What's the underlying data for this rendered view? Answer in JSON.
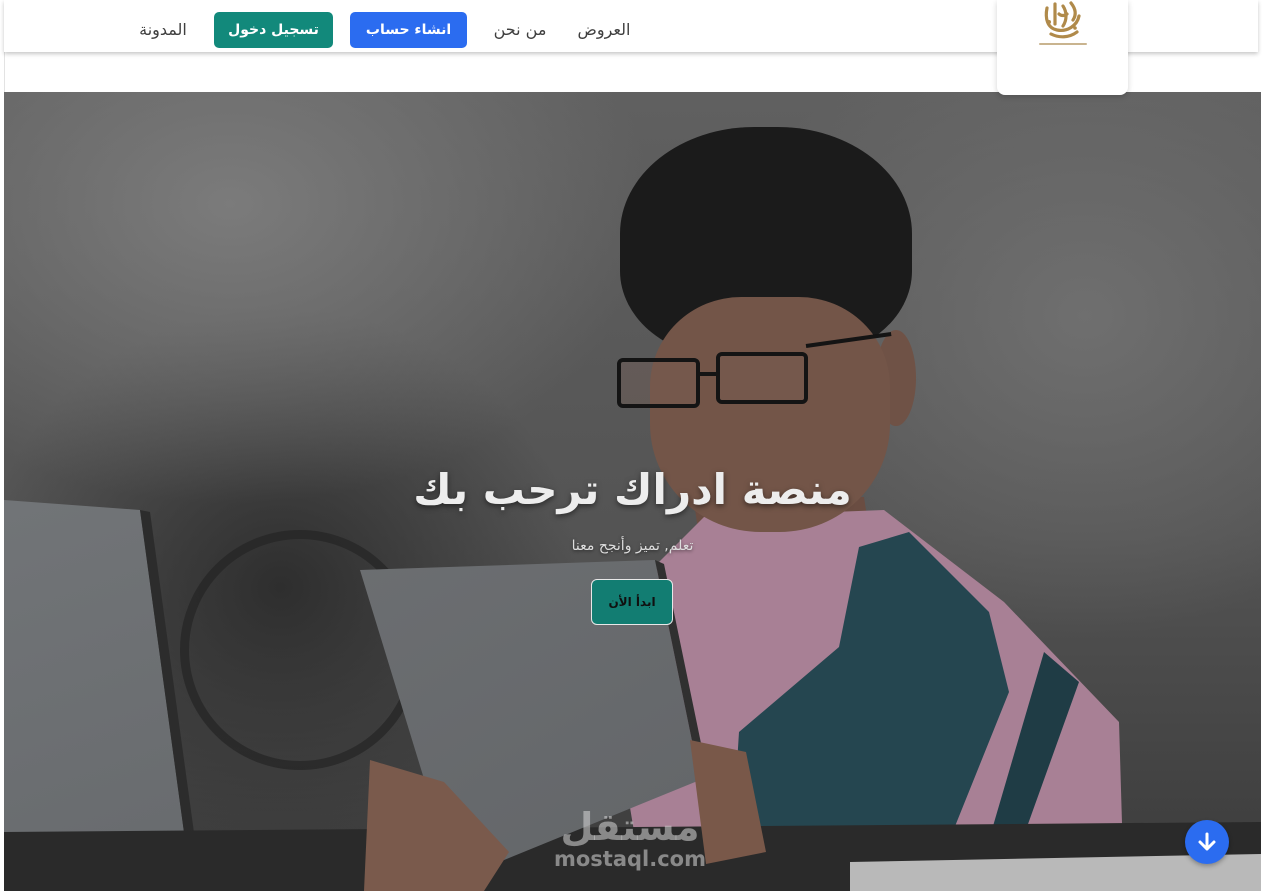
{
  "nav": {
    "items": [
      {
        "label": "العروض"
      },
      {
        "label": "من نحن"
      }
    ],
    "signup_label": "انشاء حساب",
    "login_label": "تسجيل دخول",
    "blog_label": "المدونة"
  },
  "hero": {
    "title": "منصة ادراك ترحب بك",
    "subtitle": "تعلم, تميز وأنجح معنا",
    "cta_label": "ابدأ الأن"
  },
  "watermark": {
    "arabic": "مستقل",
    "latin": "mostaql.com"
  },
  "icons": {
    "logo": "idrak-logo",
    "scroll": "arrow-down-icon"
  },
  "colors": {
    "primary": "#2b6cf0",
    "accent": "#12897b",
    "nav_text": "#3f3f3f",
    "logo_gold": "#b08a4a"
  }
}
